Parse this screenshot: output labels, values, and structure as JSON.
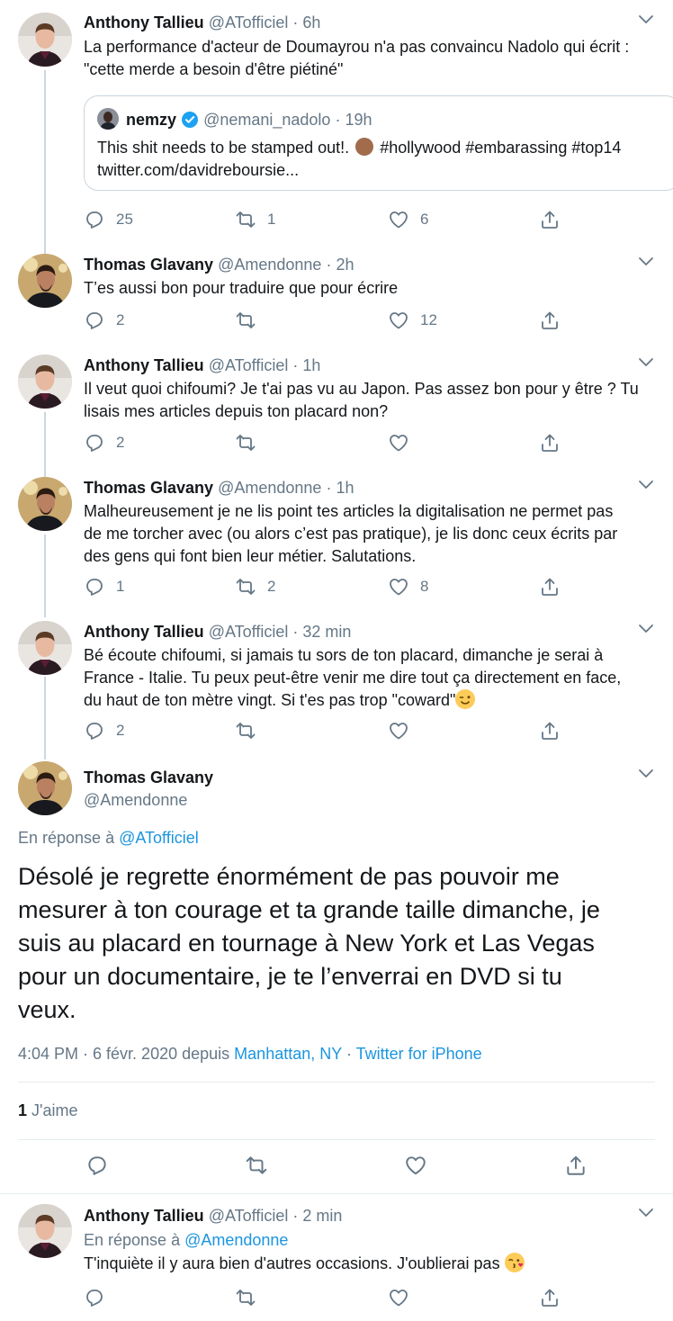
{
  "tweets": [
    {
      "name": "Anthony Tallieu",
      "handle": "@ATofficiel",
      "time": "· 6h",
      "text1": "La performance d'acteur de Doumayrou n'a pas convaincu Nadolo qui écrit :",
      "text2": "\"cette merde a besoin d'être piétiné\"",
      "replies": "25",
      "retweets": "1",
      "likes": "6"
    },
    {
      "name": "Thomas Glavany",
      "handle": "@Amendonne",
      "time": "· 2h",
      "text1": "T’es aussi bon pour traduire que pour écrire",
      "replies": "2",
      "retweets": "",
      "likes": "12"
    },
    {
      "name": "Anthony Tallieu",
      "handle": "@ATofficiel",
      "time": "· 1h",
      "text1": "Il veut quoi chifoumi? Je t'ai pas vu au Japon. Pas assez bon pour y être ? Tu",
      "text2": "lisais mes articles depuis ton placard non?",
      "replies": "2",
      "retweets": "",
      "likes": ""
    },
    {
      "name": "Thomas Glavany",
      "handle": "@Amendonne",
      "time": "· 1h",
      "text1": "Malheureusement je ne lis point tes articles la digitalisation ne permet pas",
      "text2": "de me torcher avec (ou alors c’est pas pratique), je lis donc ceux écrits par",
      "text3": "des gens qui font bien leur métier. Salutations.",
      "replies": "1",
      "retweets": "2",
      "likes": "8"
    },
    {
      "name": "Anthony Tallieu",
      "handle": "@ATofficiel",
      "time": "· 32 min",
      "text1": "Bé écoute chifoumi, si jamais tu sors de ton placard, dimanche je serai à",
      "text2": "France - Italie. Tu peux peut-être venir me dire tout ça directement en face,",
      "text3": "du haut de ton mètre vingt. Si t'es pas trop \"coward\"",
      "replies": "2",
      "retweets": "",
      "likes": ""
    }
  ],
  "quote": {
    "name": "nemzy",
    "handle": "@nemani_nadolo",
    "time": "· 19h",
    "text1": "This shit needs to be stamped out!.",
    "hashtags": "#hollywood #embarassing #top14",
    "link": "twitter.com/davidreboursie..."
  },
  "main": {
    "name": "Thomas Glavany",
    "handle": "@Amendonne",
    "reply_prefix": "En réponse à",
    "reply_to": "@ATofficiel",
    "lines": [
      "Désolé je regrette énormément de pas pouvoir me",
      "mesurer à ton courage et ta grande taille dimanche, je",
      "suis au placard en tournage à New York et Las Vegas",
      "pour un documentaire, je te l’enverrai en DVD si tu",
      "veux."
    ],
    "meta_time": "4:04 PM · 6 févr. 2020 depuis",
    "meta_place": "Manhattan, NY",
    "meta_sep": "·",
    "meta_client": "Twitter for iPhone",
    "likes_count": "1",
    "likes_label": "J'aime"
  },
  "last": {
    "name": "Anthony Tallieu",
    "handle": "@ATofficiel",
    "time": "· 2 min",
    "reply_prefix": "En réponse à",
    "reply_to": "@Amendonne",
    "text1": "T'inquiète il y aura bien d'autres occasions. J'oublierai pas"
  },
  "colors": {
    "accent": "#1b95e0",
    "muted": "#657786",
    "border": "#e6ecf0",
    "verified": "#1da1f2"
  },
  "icons": [
    "reply-icon",
    "retweet-icon",
    "like-icon",
    "share-icon",
    "chevron-down-icon",
    "verified-icon"
  ]
}
